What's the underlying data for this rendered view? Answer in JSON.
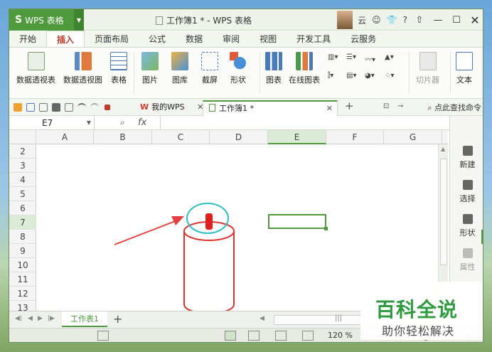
{
  "app": {
    "name": "WPS 表格",
    "logo": "S",
    "title": "工作簿1 * - WPS 表格",
    "user_initial": "云"
  },
  "menu": {
    "tabs": [
      "开始",
      "插入",
      "页面布局",
      "公式",
      "数据",
      "审阅",
      "视图",
      "开发工具",
      "云服务"
    ],
    "active": "插入"
  },
  "ribbon": {
    "pivot_table": "数据透视表",
    "pivot_chart": "数据透视图",
    "table": "表格",
    "picture": "图片",
    "gallery": "图库",
    "screenshot": "截屏",
    "shape": "形状",
    "chart": "图表",
    "online_chart": "在线图表",
    "clipper": "切片器",
    "text": "文本"
  },
  "doctabs": {
    "mywps": "我的WPS",
    "workbook": "工作簿1 *",
    "search_label": "点此查找命令"
  },
  "formula": {
    "cell_ref": "E7",
    "fx": "fx",
    "value": ""
  },
  "grid": {
    "columns": [
      "A",
      "B",
      "C",
      "D",
      "E",
      "F",
      "G"
    ],
    "selected_column": "E",
    "rows": [
      "2",
      "3",
      "4",
      "5",
      "6",
      "7",
      "8",
      "9",
      "10",
      "11",
      "12",
      "13"
    ],
    "selected_row": "7"
  },
  "taskpane": {
    "new": "新建",
    "select": "选择",
    "shape": "形状",
    "props": "属性"
  },
  "sheets": {
    "tabs": [
      "工作表1"
    ],
    "active": "工作表1"
  },
  "status": {
    "zoom": "120 %"
  },
  "watermark": {
    "title": "百科全说",
    "subtitle": "助你轻松解决"
  },
  "colors": {
    "accent": "#4f9a3c",
    "annotation": "#e04040",
    "circle": "#2fbfc6"
  }
}
